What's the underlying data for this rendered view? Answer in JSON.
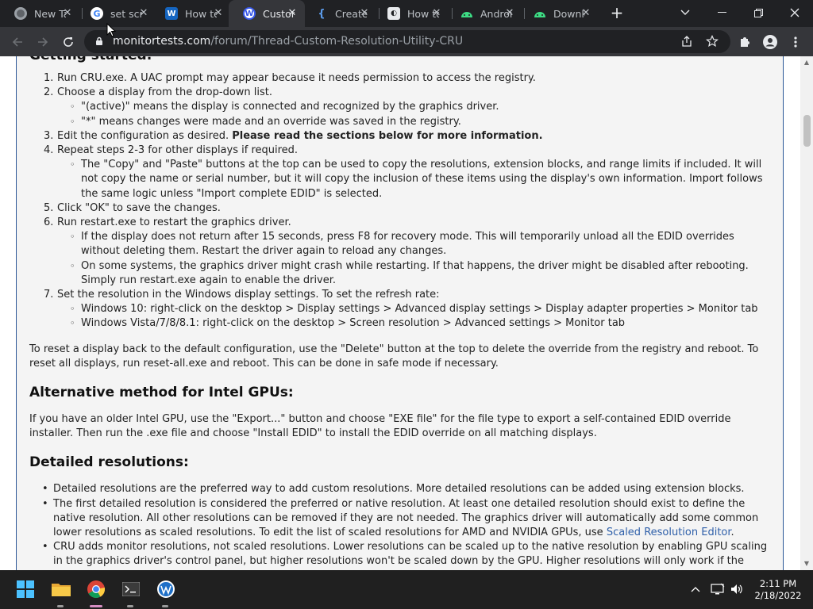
{
  "browser": {
    "tabs": [
      {
        "title": "New Tab",
        "favicon_color": "#8ab4f8",
        "active": false
      },
      {
        "title": "set screen",
        "favicon_color": "#4285f4",
        "active": false
      },
      {
        "title": "How to",
        "favicon_color": "#1565c0",
        "active": false
      },
      {
        "title": "Custom",
        "favicon_color": "#3858e9",
        "active": true
      },
      {
        "title": "Create",
        "favicon_color": "#1e88e5",
        "active": false
      },
      {
        "title": "How to",
        "favicon_color": "#e8eaed",
        "active": false
      },
      {
        "title": "Android",
        "favicon_color": "#3ddc84",
        "active": false
      },
      {
        "title": "Download",
        "favicon_color": "#3ddc84",
        "active": false
      }
    ],
    "url_domain": "monitortests.com",
    "url_path": "/forum/Thread-Custom-Resolution-Utility-CRU"
  },
  "article": {
    "section1_heading": "Getting started:",
    "steps": [
      "Run CRU.exe. A UAC prompt may appear because it needs permission to access the registry.",
      "Choose a display from the drop-down list.",
      "Edit the configuration as desired.",
      "Repeat steps 2-3 for other displays if required.",
      "Click \"OK\" to save the changes.",
      "Run restart.exe to restart the graphics driver.",
      "Set the resolution in the Windows display settings. To set the refresh rate:"
    ],
    "step2_sub": [
      "\"(active)\" means the display is connected and recognized by the graphics driver.",
      "\"*\" means changes were made and an override was saved in the registry."
    ],
    "step3_bold": "Please read the sections below for more information.",
    "step4_sub": [
      "The \"Copy\" and \"Paste\" buttons at the top can be used to copy the resolutions, extension blocks, and range limits if included. It will not copy the name or serial number, but it will copy the inclusion of these items using the display's own information. Import follows the same logic unless \"Import complete EDID\" is selected."
    ],
    "step6_sub": [
      "If the display does not return after 15 seconds, press F8 for recovery mode. This will temporarily unload all the EDID overrides without deleting them. Restart the driver again to reload any changes.",
      "On some systems, the graphics driver might crash while restarting. If that happens, the driver might be disabled after rebooting. Simply run restart.exe again to enable the driver."
    ],
    "step7_sub": [
      "Windows 10: right-click on the desktop > Display settings > Advanced display settings > Display adapter properties > Monitor tab",
      "Windows Vista/7/8/8.1: right-click on the desktop > Screen resolution > Advanced settings > Monitor tab"
    ],
    "reset_paragraph": "To reset a display back to the default configuration, use the \"Delete\" button at the top to delete the override from the registry and reboot. To reset all displays, run reset-all.exe and reboot. This can be done in safe mode if necessary.",
    "intel_heading": "Alternative method for Intel GPUs:",
    "intel_paragraph": "If you have an older Intel GPU, use the \"Export...\" button and choose \"EXE file\" for the file type to export a self-contained EDID override installer. Then run the .exe file and choose \"Install EDID\" to install the EDID override on all matching displays.",
    "detailed_heading": "Detailed resolutions:",
    "detailed_bullets": [
      "Detailed resolutions are the preferred way to add custom resolutions. More detailed resolutions can be added using extension blocks.",
      "The first detailed resolution is considered the preferred or native resolution. At least one detailed resolution should exist to define the native resolution. All other resolutions can be removed if they are not needed. The graphics driver will automatically add some common lower resolutions as scaled resolutions. To edit the list of scaled resolutions for AMD and NVIDIA GPUs, use",
      "CRU adds monitor resolutions, not scaled resolutions. Lower resolutions can be scaled up to the native resolution by enabling GPU scaling in the graphics driver's control panel, but higher resolutions won't be scaled down by the GPU. Higher resolutions will only work if the"
    ],
    "scaled_link": "Scaled Resolution Editor",
    "scaled_link_after": "."
  },
  "taskbar": {
    "time": "2:11 PM",
    "date": "2/18/2022"
  }
}
